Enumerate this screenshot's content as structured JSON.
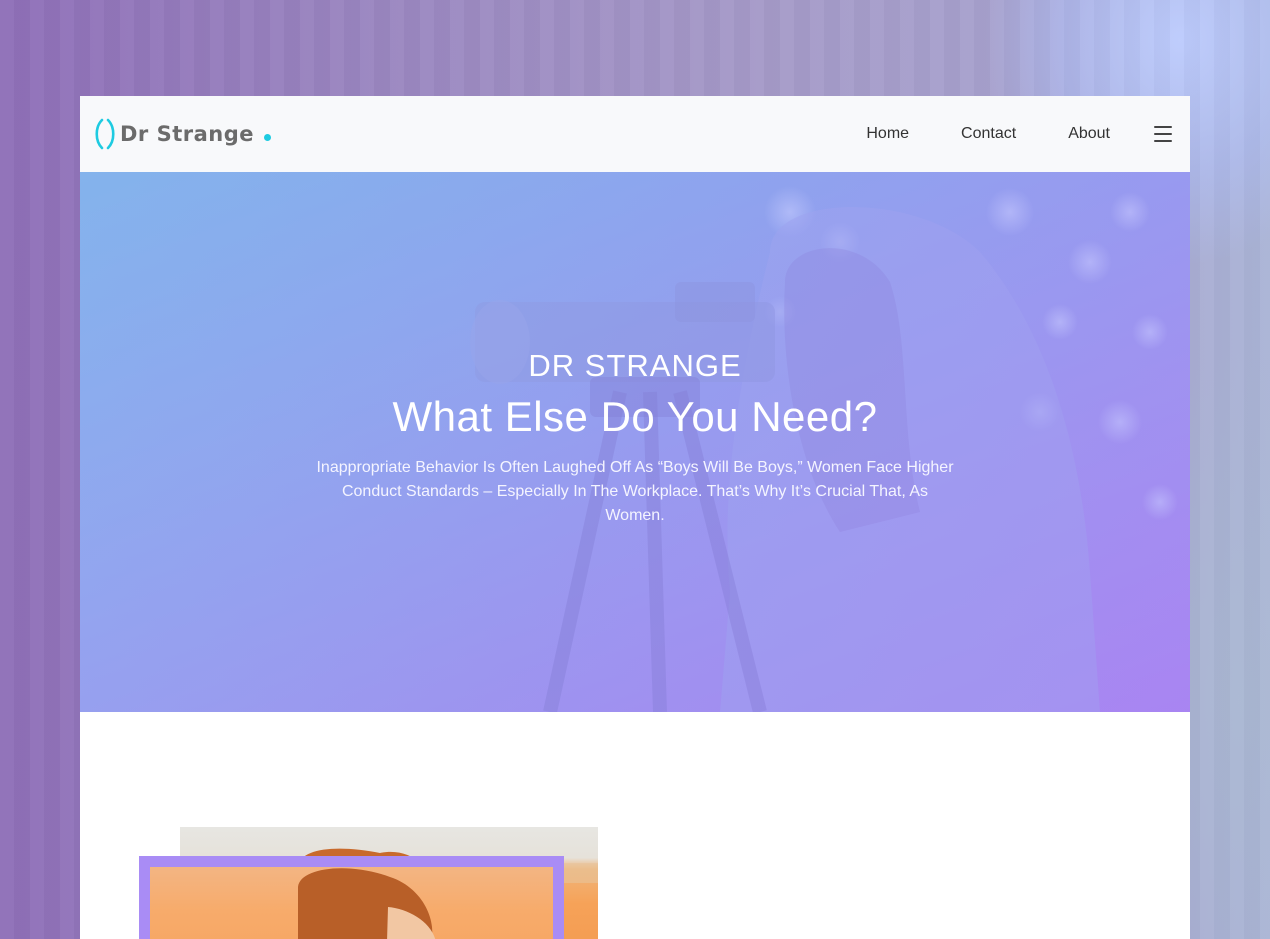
{
  "brand": {
    "name": "Dr Strange",
    "accent_color": "#1ecbe1"
  },
  "nav": {
    "items": [
      {
        "label": "Home"
      },
      {
        "label": "Contact"
      },
      {
        "label": "About"
      }
    ],
    "menu_icon": "hamburger-menu-icon"
  },
  "hero": {
    "kicker": "DR STRANGE",
    "title": "What Else Do You Need?",
    "text": "Inappropriate Behavior Is Often Laughed Off As “Boys Will Be Boys,” Women Face Higher Conduct Standards – Especially In The Workplace. That’s Why It’s Crucial That, As Women."
  },
  "colors": {
    "frame_accent": "#a98cf5",
    "navbar_bg": "#f8f9fb"
  }
}
